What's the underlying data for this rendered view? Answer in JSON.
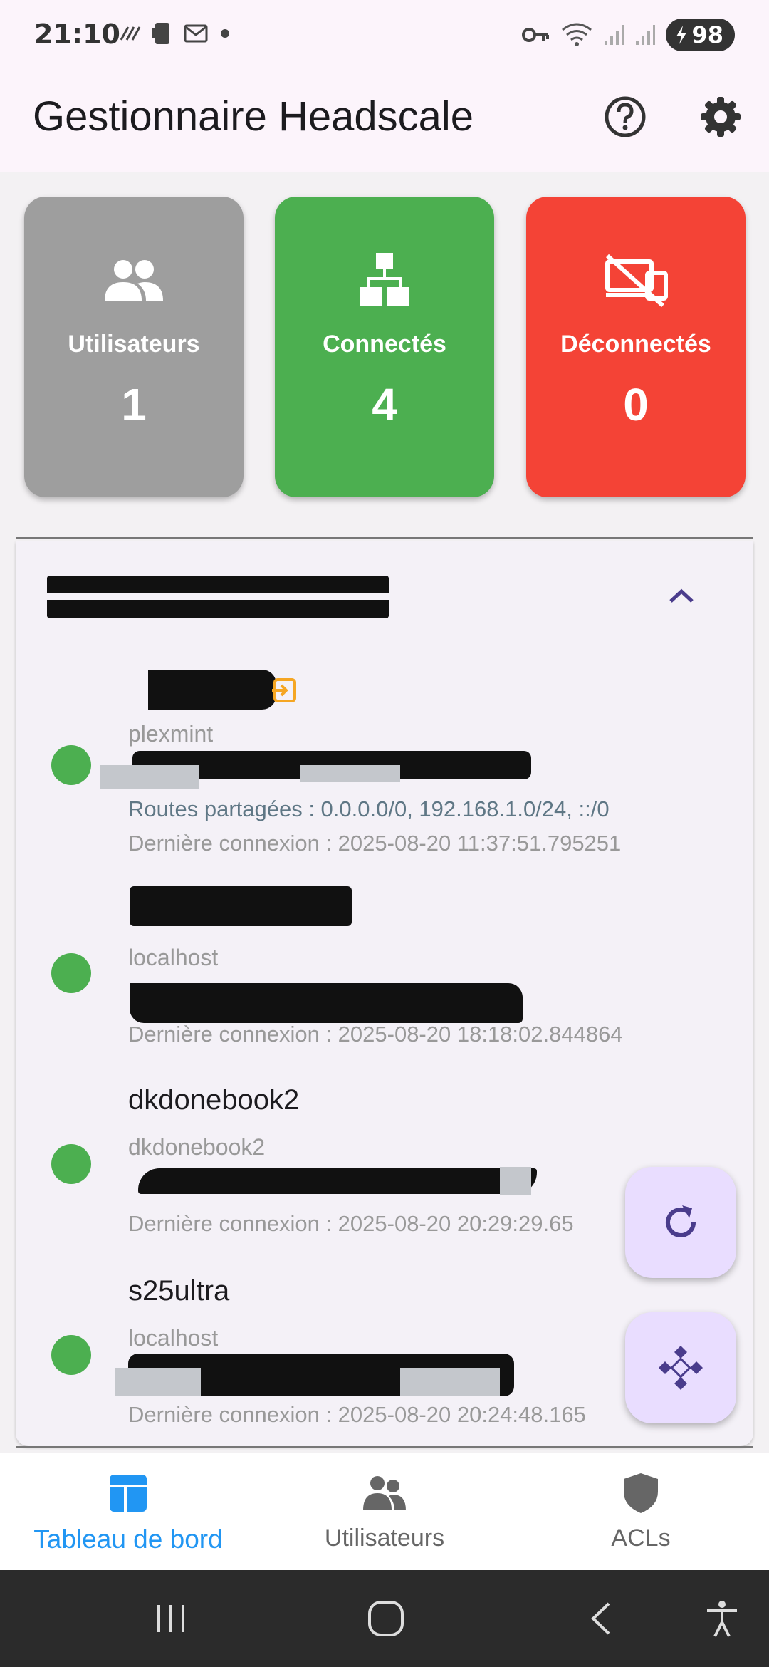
{
  "status_bar": {
    "time": "21:10",
    "battery": "98",
    "icons": [
      "signal-stripes-icon",
      "sim-icon",
      "mail-icon",
      "dot-icon",
      "vpn-key-icon",
      "wifi-icon",
      "cell-signal-icon",
      "cell-signal-icon",
      "battery-charging-icon"
    ]
  },
  "app_bar": {
    "title": "Gestionnaire Headscale",
    "actions": [
      "help-icon",
      "settings-icon"
    ]
  },
  "stats": [
    {
      "label": "Utilisateurs",
      "value": "1",
      "icon": "users-icon",
      "color": "#9e9e9e"
    },
    {
      "label": "Connectés",
      "value": "4",
      "icon": "network-icon",
      "color": "#4caf50"
    },
    {
      "label": "Déconnectés",
      "value": "0",
      "icon": "desktop-off-icon",
      "color": "#f44336"
    }
  ],
  "devices": [
    {
      "name": "",
      "host": "plexmint",
      "routes": "Routes partagées : 0.0.0.0/0, 192.168.1.0/24, ::/0",
      "last_seen": "Dernière connexion : 2025-08-20 11:37:51.795251",
      "online": true,
      "exit_node": true
    },
    {
      "name": "",
      "host": "localhost",
      "last_seen": "Dernière connexion : 2025-08-20 18:18:02.844864",
      "online": true
    },
    {
      "name": "dkdonebook2",
      "host": "dkdonebook2",
      "last_seen": "Dernière connexion : 2025-08-20 20:29:29.65",
      "online": true
    },
    {
      "name": "s25ultra",
      "host": "localhost",
      "last_seen": "Dernière connexion : 2025-08-20 20:24:48.165",
      "online": true
    }
  ],
  "fabs": [
    "refresh-icon",
    "network-nodes-icon"
  ],
  "colors": {
    "accent": "#2196f3",
    "fab": "#e9ddff",
    "online": "#4caf50",
    "primary_icon": "#4a3c8c"
  },
  "bottom_nav": {
    "items": [
      {
        "label": "Tableau de bord",
        "icon": "dashboard-icon",
        "active": true
      },
      {
        "label": "Utilisateurs",
        "icon": "users-icon",
        "active": false
      },
      {
        "label": "ACLs",
        "icon": "shield-icon",
        "active": false
      }
    ]
  }
}
